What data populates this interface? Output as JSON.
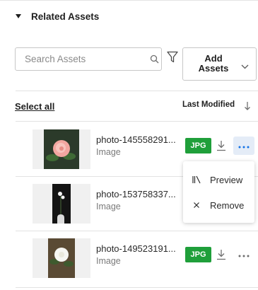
{
  "section": {
    "title": "Related Assets"
  },
  "search": {
    "placeholder": "Search Assets",
    "value": ""
  },
  "toolbar": {
    "add_assets_line1": "Add",
    "add_assets_line2": "Assets"
  },
  "list_header": {
    "select_all": "Select all",
    "sort_label": "Last Modified"
  },
  "assets": [
    {
      "name": "photo-145558291...",
      "type": "Image",
      "format": "JPG"
    },
    {
      "name": "photo-153758337...",
      "type": "Image",
      "format": ""
    },
    {
      "name": "photo-149523191...",
      "type": "Image",
      "format": "JPG"
    }
  ],
  "menu": {
    "preview": "Preview",
    "remove": "Remove"
  },
  "colors": {
    "badge_green": "#1f9f3a",
    "active_more_bg": "#e4ecf7",
    "link_blue": "#1473e6"
  }
}
